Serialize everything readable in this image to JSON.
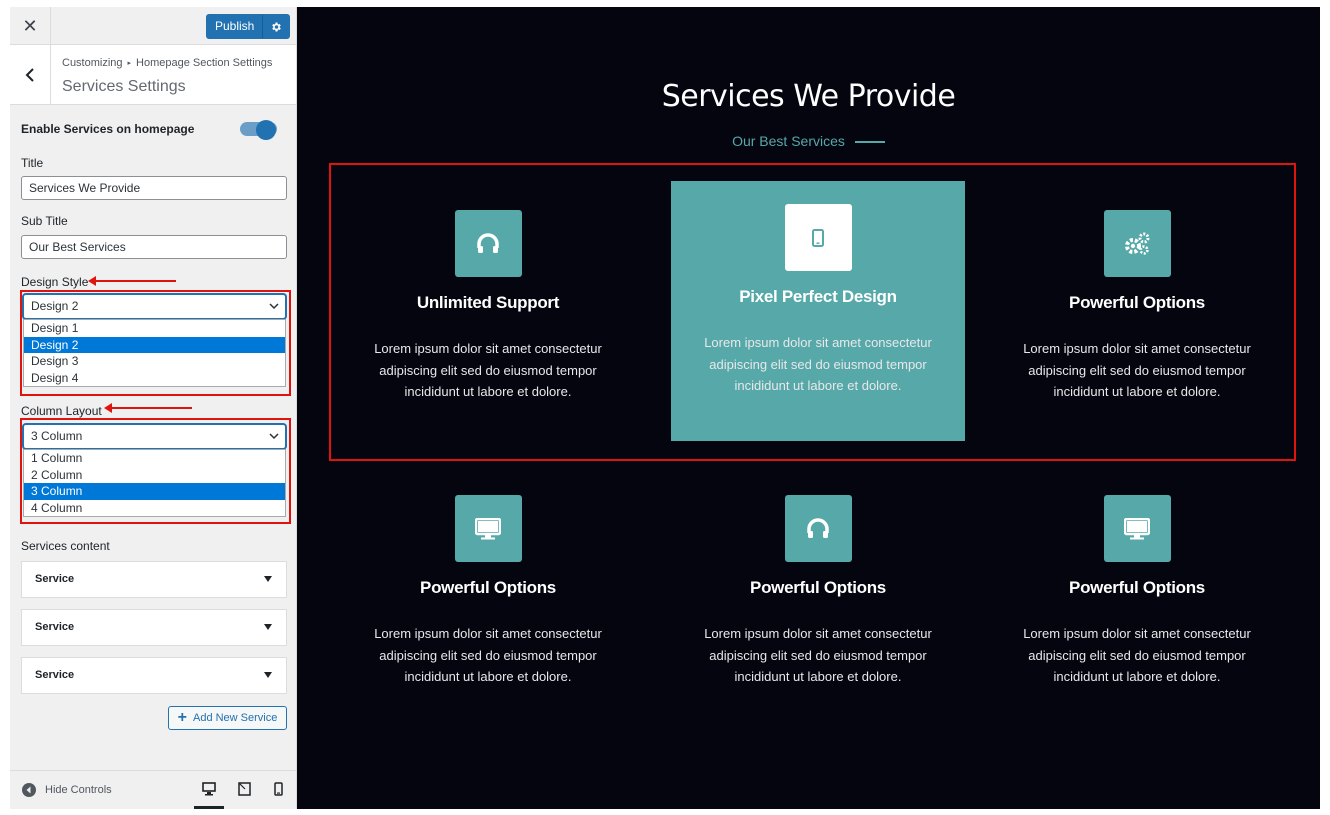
{
  "topbar": {
    "close_symbol": "✕",
    "publish_label": "Publish"
  },
  "section": {
    "crumb_root": "Customizing",
    "crumb_sep": "▸",
    "crumb_parent": "Homepage Section Settings",
    "title": "Services Settings"
  },
  "controls": {
    "enable_label": "Enable Services on homepage",
    "enable_on": true,
    "title_label": "Title",
    "title_value": "Services We Provide",
    "subtitle_label": "Sub Title",
    "subtitle_value": "Our Best Services",
    "design_label": "Design Style",
    "design_selected": "Design 2",
    "design_options": [
      "Design 1",
      "Design 2",
      "Design 3",
      "Design 4"
    ],
    "column_label": "Column Layout",
    "column_selected": "3 Column",
    "column_options": [
      "1 Column",
      "2 Column",
      "3 Column",
      "4 Column"
    ],
    "services_content_label": "Services content",
    "service_items": [
      "Service",
      "Service",
      "Service"
    ],
    "add_service_label": "Add New Service"
  },
  "footer": {
    "hide_controls_label": "Hide Controls"
  },
  "preview": {
    "heading": "Services We Provide",
    "subheading": "Our Best Services",
    "accent_color": "#57a8a8",
    "cards": [
      {
        "icon": "headphones-icon",
        "title": "Unlimited Support",
        "text": "Lorem ipsum dolor sit amet consectetur adipiscing elit sed do eiusmod tempor incididunt ut labore et dolore."
      },
      {
        "icon": "mobile-icon",
        "title": "Pixel Perfect Design",
        "text": "Lorem ipsum dolor sit amet consectetur adipiscing elit sed do eiusmod tempor incididunt ut labore et dolore."
      },
      {
        "icon": "gears-icon",
        "title": "Powerful Options",
        "text": "Lorem ipsum dolor sit amet consectetur adipiscing elit sed do eiusmod tempor incididunt ut labore et dolore."
      },
      {
        "icon": "desktop-icon",
        "title": "Powerful Options",
        "text": "Lorem ipsum dolor sit amet consectetur adipiscing elit sed do eiusmod tempor incididunt ut labore et dolore."
      },
      {
        "icon": "headphones-icon",
        "title": "Powerful Options",
        "text": "Lorem ipsum dolor sit amet consectetur adipiscing elit sed do eiusmod tempor incididunt ut labore et dolore."
      },
      {
        "icon": "desktop-icon",
        "title": "Powerful Options",
        "text": "Lorem ipsum dolor sit amet consectetur adipiscing elit sed do eiusmod tempor incididunt ut labore et dolore."
      }
    ]
  }
}
